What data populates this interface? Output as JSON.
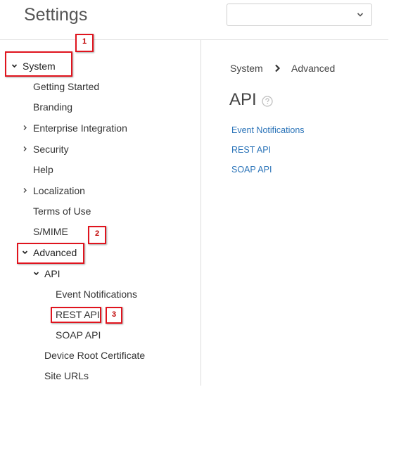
{
  "header": {
    "title": "Settings",
    "select_value": ""
  },
  "sidebar": {
    "items": [
      {
        "label": "System"
      },
      {
        "label": "Getting Started"
      },
      {
        "label": "Branding"
      },
      {
        "label": "Enterprise Integration"
      },
      {
        "label": "Security"
      },
      {
        "label": "Help"
      },
      {
        "label": "Localization"
      },
      {
        "label": "Terms of Use"
      },
      {
        "label": "S/MIME"
      },
      {
        "label": "Advanced"
      },
      {
        "label": "API"
      },
      {
        "label": "Event Notifications"
      },
      {
        "label": "REST API"
      },
      {
        "label": "SOAP API"
      },
      {
        "label": "Device Root Certificate"
      },
      {
        "label": "Site URLs"
      }
    ]
  },
  "annotations": {
    "badges": [
      "1",
      "2",
      "3"
    ]
  },
  "main": {
    "breadcrumb": [
      "System",
      "Advanced"
    ],
    "section_title": "API",
    "links": [
      "Event Notifications",
      "REST API",
      "SOAP API"
    ]
  },
  "colors": {
    "callout": "#e0141e",
    "link": "#2a73b8",
    "divider": "#dddddd"
  },
  "icons": {
    "select_chevron": "chevron-down-icon",
    "expanded": "caret-down-icon",
    "collapsed": "caret-right-icon",
    "breadcrumb_separator": "chevron-right-icon",
    "help": "help-circle-icon"
  }
}
